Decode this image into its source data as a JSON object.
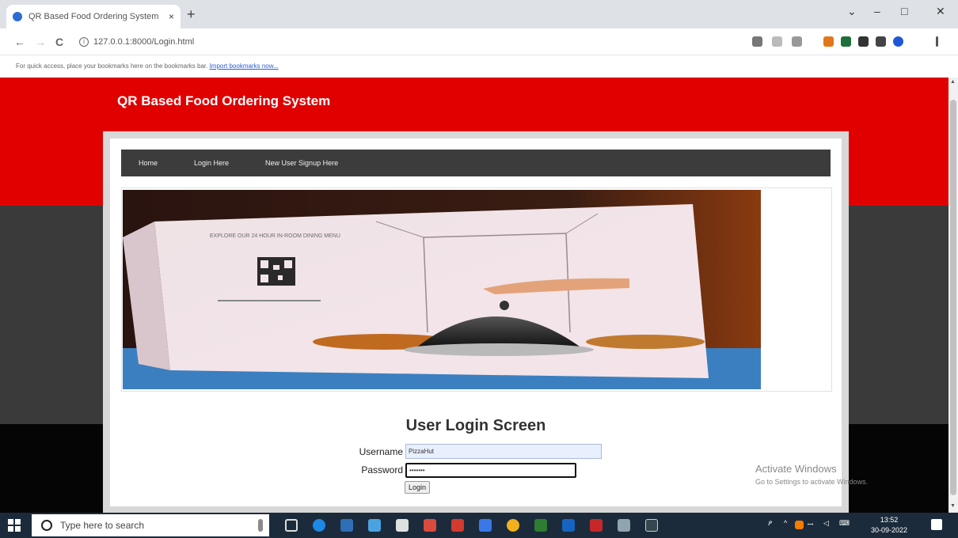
{
  "browser": {
    "tab_title": "QR Based Food Ordering System",
    "tab_close": "×",
    "new_tab": "+",
    "url": "127.0.0.1:8000/Login.html",
    "bookmarks_prompt": "For quick access, place your bookmarks here on the bookmarks bar.",
    "bookmarks_link": "Import bookmarks now...",
    "controls": {
      "back": "←",
      "forward": "→",
      "reload": "C",
      "minimize": "–",
      "maximize": "□",
      "close": "✕",
      "tab_menu": "⌄"
    },
    "extensions": [
      "key-icon",
      "share-icon",
      "star-icon",
      "fox-extension-icon",
      "shield-extension-icon",
      "puzzle-icon",
      "sidebar-icon",
      "profile-icon",
      "menu-icon"
    ]
  },
  "site": {
    "title": "QR Based Food Ordering System",
    "nav": [
      "Home",
      "Login Here",
      "New User Signup Here"
    ]
  },
  "banner": {
    "card_text": "EXPLORE OUR 24 HOUR IN-ROOM DINING MENU",
    "colors": {
      "card": "#f2e6ea",
      "sky": "#3b7fc0",
      "wood": "#6b2a0e"
    }
  },
  "login": {
    "heading": "User Login Screen",
    "username_label": "Username",
    "username_value": "PizzaHut",
    "password_label": "Password",
    "password_value": "•••••••",
    "submit_label": "Login"
  },
  "watermark": {
    "line1": "Activate Windows",
    "line2": "Go to Settings to activate Windows."
  },
  "taskbar": {
    "search_placeholder": "Type here to search",
    "time": "13:52",
    "date": "30-09-2022"
  },
  "colors": {
    "header_red": "#e00000",
    "nav_dark": "#3c3c3c",
    "band_dark": "#3a3a3a",
    "taskbar": "#1b2b3b"
  }
}
